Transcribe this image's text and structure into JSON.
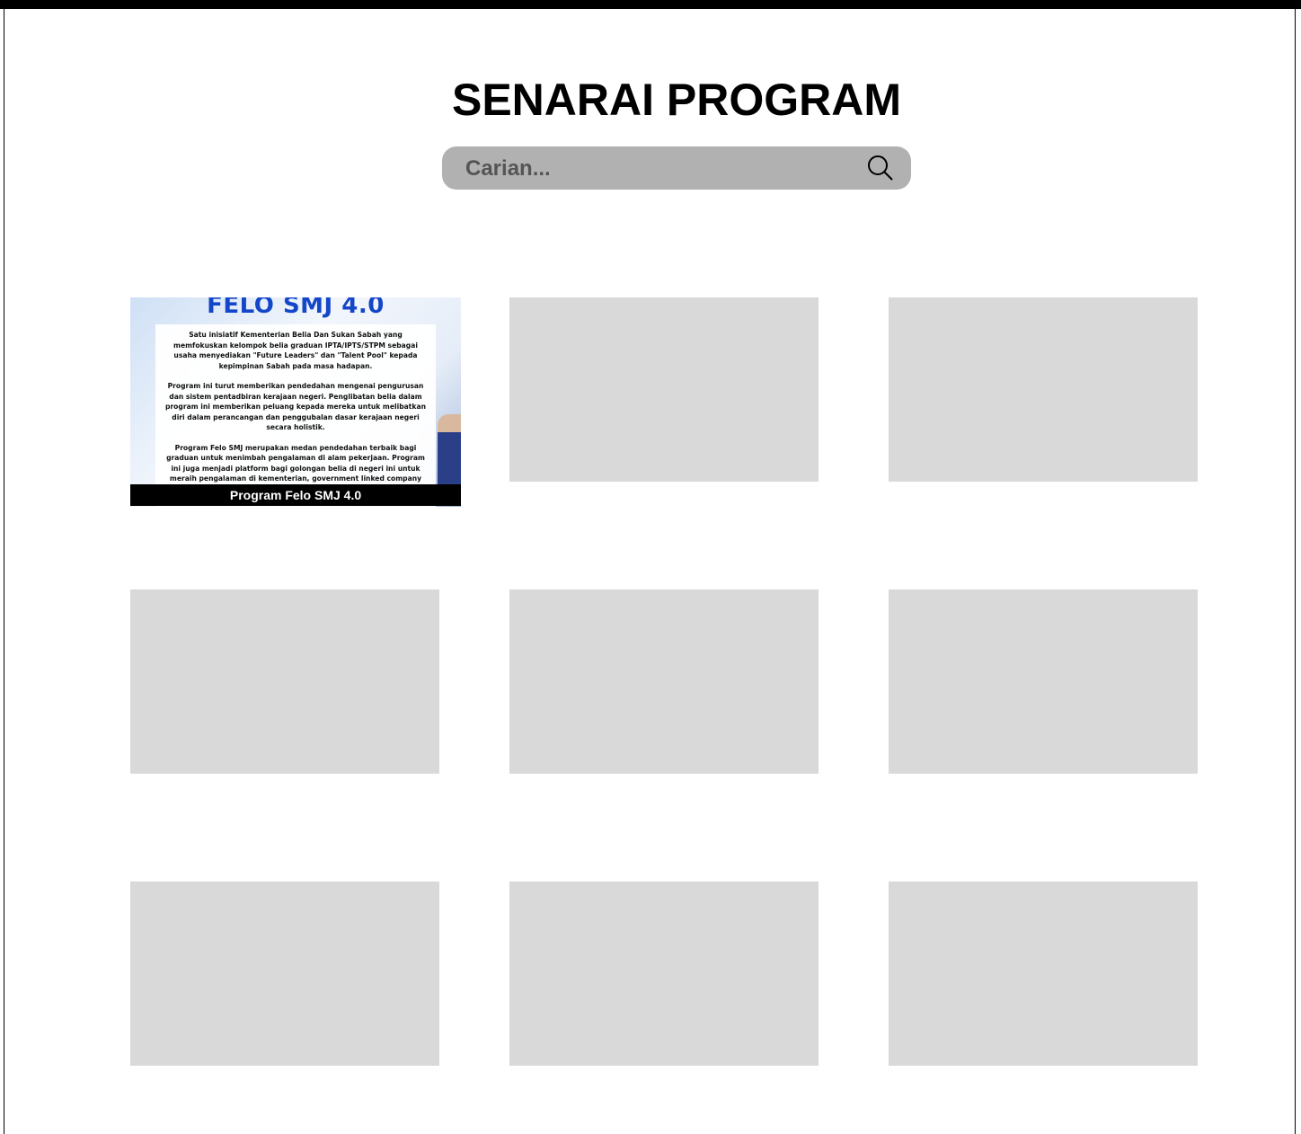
{
  "page": {
    "title": "SENARAI PROGRAM"
  },
  "search": {
    "placeholder": "Carian...",
    "value": "",
    "icon": "search-icon"
  },
  "programs": [
    {
      "caption": "Program Felo SMJ 4.0",
      "poster": {
        "heading": "FELO SMJ 4.0",
        "paragraphs": [
          "Satu inisiatif Kementerian Belia Dan Sukan Sabah yang memfokuskan kelompok belia graduan IPTA/IPTS/STPM sebagai usaha menyediakan \"Future Leaders\" dan \"Talent Pool\" kepada kepimpinan Sabah pada masa hadapan.",
          "Program ini turut memberikan pendedahan mengenai pengurusan dan sistem pentadbiran kerajaan negeri. Penglibatan belia dalam program ini memberikan peluang kepada mereka untuk melibatkan diri dalam perancangan dan penggubalan dasar kerajaan negeri secara holistik.",
          "Program Felo SMJ merupakan medan pendedahan terbaik bagi graduan untuk menimbah pengalaman di alam pekerjaan. Program ini juga menjadi platform bagi golongan belia di negeri ini untuk meraih pengalaman di kementerian, government linked company (GLC) dan badan berkanun negeri Sabah."
        ]
      }
    }
  ],
  "colors": {
    "placeholder_card": "#d9d9d9",
    "search_bg": "#b1b1b1",
    "heading_blue": "#1346c8"
  }
}
